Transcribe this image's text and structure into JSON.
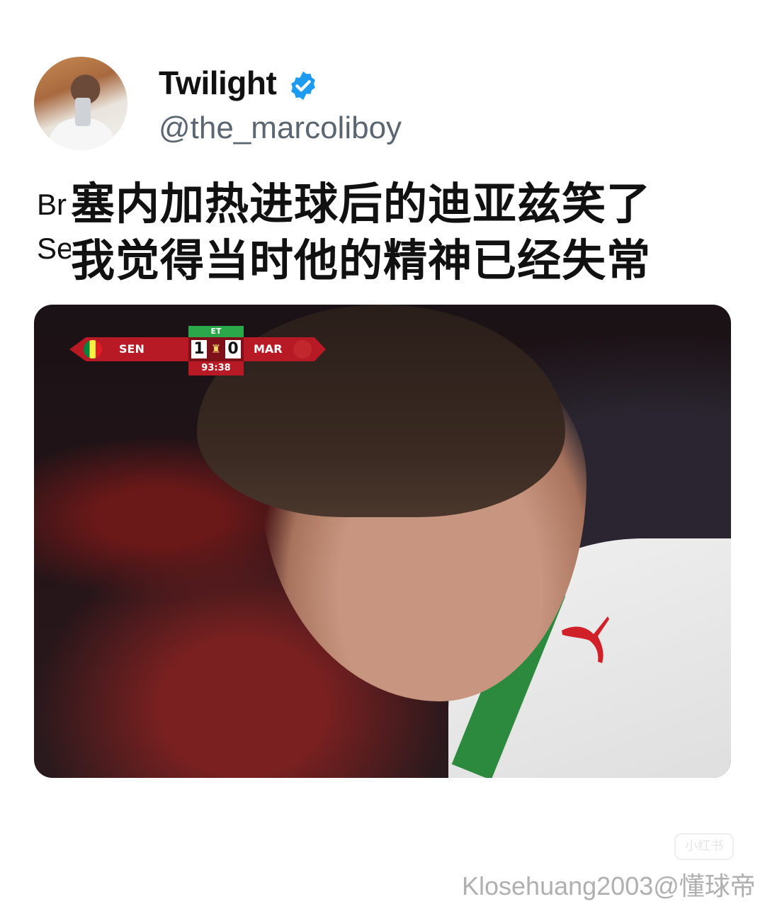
{
  "tweet": {
    "display_name": "Twilight",
    "handle": "@the_marcoliboy",
    "text_line_1_fragment": "Br",
    "text_line_2_fragment": "Se"
  },
  "caption": {
    "line_1": "塞内加热进球后的迪亚兹笑了",
    "line_2": "我觉得当时他的精神已经失常"
  },
  "scoreboard": {
    "period": "ET",
    "home_team": "SEN",
    "home_score": "1",
    "away_score": "0",
    "away_team": "MAR",
    "clock": "93:38"
  },
  "watermark": {
    "credit": "Klosehuang2003@懂球帝",
    "logo_text": "小红书"
  },
  "colors": {
    "verified": "#1d9bf0",
    "scoreboard_red": "#b71a24",
    "scoreboard_green": "#2aa84a"
  }
}
